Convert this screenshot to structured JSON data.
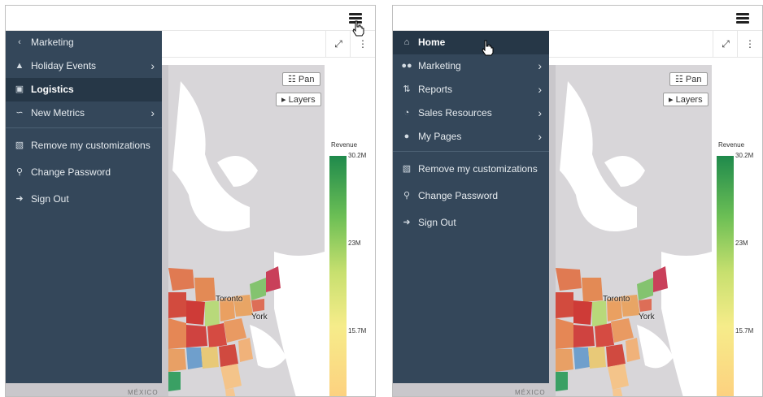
{
  "left_panel": {
    "menu": {
      "back_item": {
        "icon": "chevron-left-icon",
        "label": "Marketing"
      },
      "items": [
        {
          "icon": "tree-icon",
          "label": "Holiday Events",
          "has_submenu": true,
          "active": false
        },
        {
          "icon": "map-icon",
          "label": "Logistics",
          "has_submenu": false,
          "active": true
        },
        {
          "icon": "line-chart-icon",
          "label": "New Metrics",
          "has_submenu": true,
          "active": false
        }
      ],
      "actions": [
        {
          "icon": "trash-icon",
          "label": "Remove my customizations"
        },
        {
          "icon": "key-icon",
          "label": "Change Password"
        },
        {
          "icon": "sign-out-icon",
          "label": "Sign Out"
        }
      ]
    }
  },
  "right_panel": {
    "menu": {
      "items": [
        {
          "icon": "home-icon",
          "label": "Home",
          "has_submenu": false,
          "active": true
        },
        {
          "icon": "users-icon",
          "label": "Marketing",
          "has_submenu": true,
          "active": false
        },
        {
          "icon": "sort-icon",
          "label": "Reports",
          "has_submenu": true,
          "active": false
        },
        {
          "icon": "pie-chart-icon",
          "label": "Sales Resources",
          "has_submenu": true,
          "active": false
        },
        {
          "icon": "user-icon",
          "label": "My Pages",
          "has_submenu": true,
          "active": false
        }
      ],
      "actions": [
        {
          "icon": "trash-icon",
          "label": "Remove my customizations"
        },
        {
          "icon": "key-icon",
          "label": "Change Password"
        },
        {
          "icon": "sign-out-icon",
          "label": "Sign Out"
        }
      ]
    }
  },
  "map": {
    "pan_label": "Pan",
    "layers_label": "Layers",
    "city_toronto": "Toronto",
    "city_new_york": "York",
    "country_label": "MÉXICO"
  },
  "legend": {
    "title": "Revenue",
    "ticks": [
      "30.2M",
      "23M",
      "15.7M"
    ],
    "colors": [
      "#1f8a4c",
      "#6cbf55",
      "#c8e06f",
      "#f6ec8a",
      "#fdd07f"
    ]
  },
  "colors": {
    "menu_bg": "#34475a",
    "menu_active_bg": "#263747",
    "map_land": "#d5d3d6"
  }
}
